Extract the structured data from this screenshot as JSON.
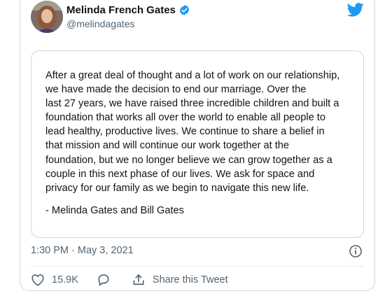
{
  "author": {
    "name": "Melinda French Gates",
    "handle": "@melindagates"
  },
  "statement": {
    "text": "After a great deal of thought and a lot of work on our relationship,\nwe have made the decision to end our marriage. Over the\nlast 27 years, we have raised three incredible children and built a\nfoundation that works all over the world to enable all people to\nlead healthy, productive lives. We continue to share a belief in\nthat mission and will continue our work together at the\nfoundation, but we no longer believe we can grow together as a\ncouple in this next phase of our lives. We ask for space and\nprivacy for our family as we begin to navigate this new life.",
    "signature": "- Melinda Gates and Bill Gates"
  },
  "meta": {
    "timestamp": "1:30 PM · May 3, 2021"
  },
  "actions": {
    "like_count": "15.9K",
    "share_label": "Share this Tweet"
  },
  "colors": {
    "brand": "#1d9bf0",
    "muted": "#536471",
    "border": "#cfd9de"
  },
  "icons": [
    "twitter-bird-icon",
    "verified-badge-icon",
    "info-icon",
    "heart-icon",
    "reply-icon",
    "share-icon"
  ]
}
